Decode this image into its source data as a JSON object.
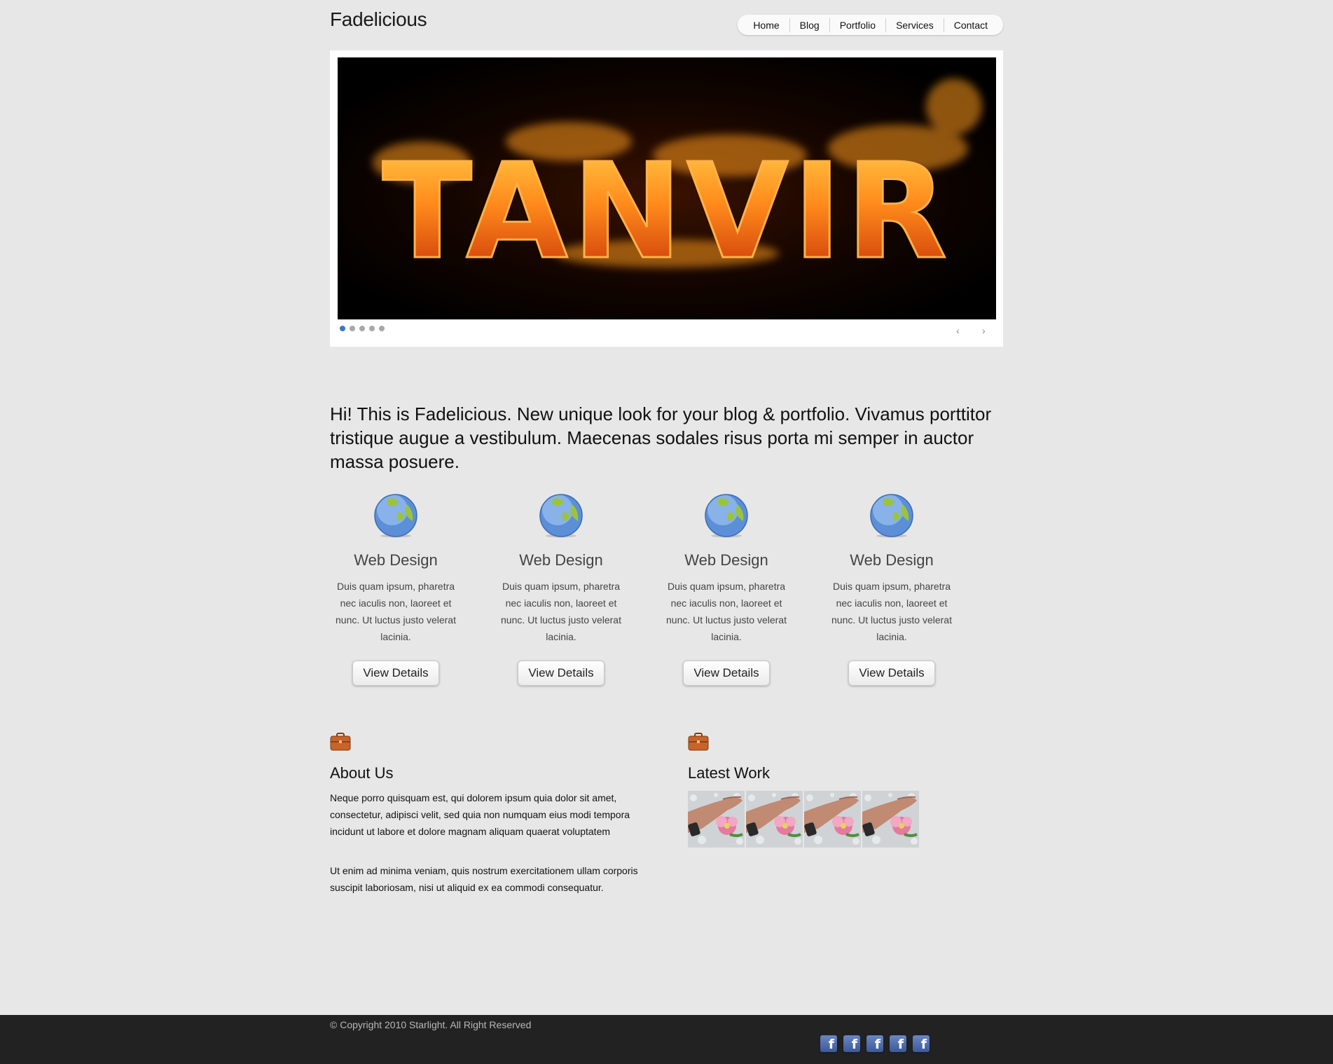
{
  "header": {
    "logo": "Fadelicious",
    "nav": [
      "Home",
      "Blog",
      "Portfolio",
      "Services",
      "Contact"
    ]
  },
  "slider": {
    "banner_text": "TANVIR",
    "dot_count": 5,
    "active_dot": 1,
    "prev_icon": "chevron-left-icon",
    "next_icon": "chevron-right-icon"
  },
  "intro": {
    "text": "Hi! This is Fadelicious. New unique look for your blog & portfolio. Vivamus porttitor tristique augue a vestibulum. Maecenas sodales risus porta mi semper in auctor massa posuere."
  },
  "features": [
    {
      "icon": "globe-icon",
      "title": "Web Design",
      "text": "Duis quam ipsum, pharetra nec iaculis non, laoreet et nunc. Ut luctus justo velerat lacinia.",
      "button": "View Details"
    },
    {
      "icon": "globe-icon",
      "title": "Web Design",
      "text": "Duis quam ipsum, pharetra nec iaculis non, laoreet et nunc. Ut luctus justo velerat lacinia.",
      "button": "View Details"
    },
    {
      "icon": "globe-icon",
      "title": "Web Design",
      "text": "Duis quam ipsum, pharetra nec iaculis non, laoreet et nunc. Ut luctus justo velerat lacinia.",
      "button": "View Details"
    },
    {
      "icon": "globe-icon",
      "title": "Web Design",
      "text": "Duis quam ipsum, pharetra nec iaculis non, laoreet et nunc. Ut luctus justo velerat lacinia.",
      "button": "View Details"
    }
  ],
  "about": {
    "icon": "briefcase-icon",
    "title": "About Us",
    "paragraphs": [
      "Neque porro quisquam est, qui dolorem ipsum quia dolor sit amet, consectetur, adipisci velit, sed quia non numquam eius modi tempora incidunt ut labore et dolore magnam aliquam quaerat voluptatem",
      "Ut enim ad minima veniam, quis nostrum exercitationem ullam corporis suscipit laboriosam, nisi ut aliquid ex ea commodi consequatur."
    ]
  },
  "latest_work": {
    "icon": "briefcase-icon",
    "title": "Latest Work",
    "thumb_count": 4
  },
  "footer": {
    "copyright": "© Copyright 2010 Starlight. All Right Reserved",
    "social_icons": [
      "facebook-icon",
      "facebook-icon",
      "facebook-icon",
      "facebook-icon",
      "facebook-icon"
    ],
    "social_glyph": "f"
  },
  "colors": {
    "background": "#e7e7e7",
    "footer": "#222222",
    "active_dot": "#3a78c4",
    "facebook": "#3b5998"
  }
}
